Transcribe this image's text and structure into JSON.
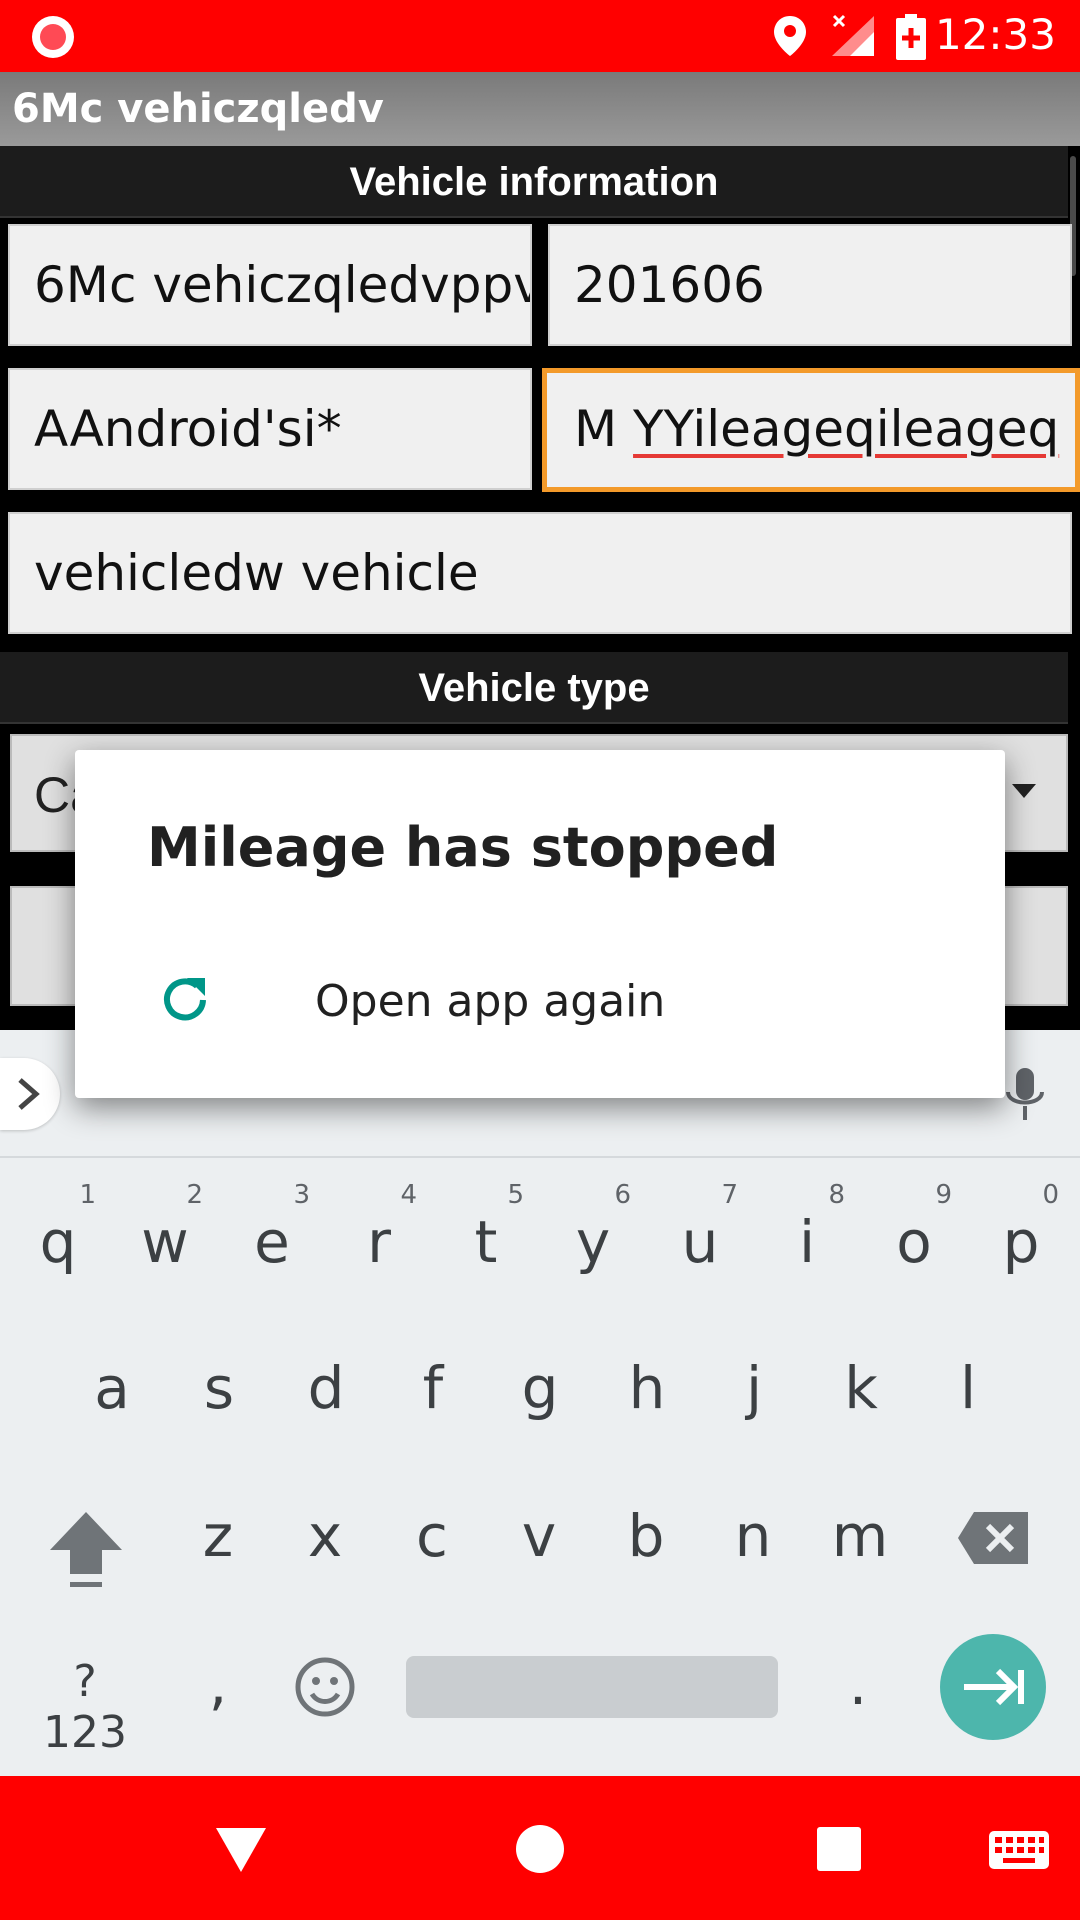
{
  "status_bar": {
    "time": "12:33",
    "icons": [
      "record-icon",
      "location-icon",
      "signal-no-service-icon",
      "battery-charging-icon"
    ]
  },
  "action_bar": {
    "title": "6Mc vehiczqledv"
  },
  "form": {
    "section_info": "Vehicle information",
    "name_value": "6Mc vehiczqledvppv",
    "year_value": "201606",
    "make_value": "AAndroid'si*",
    "model_prefix": "M ",
    "model_misspelled": "YYileageqileageq",
    "description_value": "vehicledw vehicle",
    "section_type": "Vehicle type",
    "type_value": "Ca"
  },
  "dialog": {
    "title": "Mileage has stopped",
    "action_label": "Open app again",
    "action_icon": "refresh-icon"
  },
  "keyboard": {
    "row1": [
      {
        "key": "q",
        "hint": "1"
      },
      {
        "key": "w",
        "hint": "2"
      },
      {
        "key": "e",
        "hint": "3"
      },
      {
        "key": "r",
        "hint": "4"
      },
      {
        "key": "t",
        "hint": "5"
      },
      {
        "key": "y",
        "hint": "6"
      },
      {
        "key": "u",
        "hint": "7"
      },
      {
        "key": "i",
        "hint": "8"
      },
      {
        "key": "o",
        "hint": "9"
      },
      {
        "key": "p",
        "hint": "0"
      }
    ],
    "row2": [
      "a",
      "s",
      "d",
      "f",
      "g",
      "h",
      "j",
      "k",
      "l"
    ],
    "row3": [
      "z",
      "x",
      "c",
      "v",
      "b",
      "n",
      "m"
    ],
    "symbols_label": "?123",
    "comma_label": ",",
    "period_label": "."
  },
  "colors": {
    "status_bar": "#ff0000",
    "nav_bar": "#ff0000",
    "focus_border": "#f39a2a",
    "accent_teal": "#009688",
    "enter_key": "#4db6ac"
  }
}
